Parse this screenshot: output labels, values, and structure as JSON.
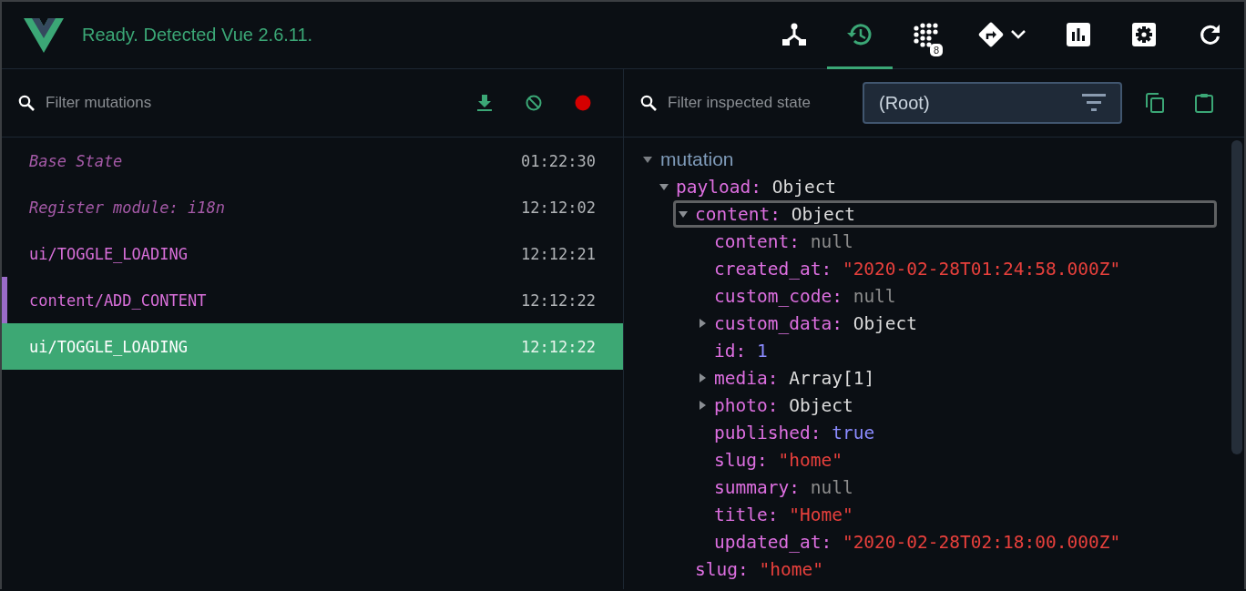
{
  "header": {
    "status": "Ready. Detected Vue 2.6.11.",
    "tabs": [
      {
        "kind": "components",
        "selected": false
      },
      {
        "kind": "vuex",
        "selected": true
      },
      {
        "kind": "events",
        "selected": false,
        "badge": "8"
      },
      {
        "kind": "routing",
        "selected": false
      },
      {
        "kind": "performance",
        "selected": false
      },
      {
        "kind": "settings",
        "selected": false
      },
      {
        "kind": "refresh",
        "selected": false
      }
    ]
  },
  "mutations_panel": {
    "filter": {
      "placeholder": "Filter mutations"
    },
    "actions": [
      {
        "kind": "export"
      },
      {
        "kind": "clear"
      },
      {
        "kind": "record",
        "on": true
      }
    ],
    "items": [
      {
        "label": "Base State",
        "time": "01:22:30",
        "kind": "meta",
        "selected": false,
        "inspected": false
      },
      {
        "label": "Register module: i18n",
        "time": "12:12:02",
        "kind": "meta",
        "selected": false,
        "inspected": false
      },
      {
        "label": "ui/TOGGLE_LOADING",
        "time": "12:12:21",
        "kind": "mutation",
        "selected": false,
        "inspected": false
      },
      {
        "label": "content/ADD_CONTENT",
        "time": "12:12:22",
        "kind": "mutation",
        "selected": false,
        "inspected": true
      },
      {
        "label": "ui/TOGGLE_LOADING",
        "time": "12:12:22",
        "kind": "mutation",
        "selected": true,
        "inspected": false
      }
    ]
  },
  "inspector": {
    "filter": {
      "placeholder": "Filter inspected state"
    },
    "module_select": {
      "value": "(Root)"
    },
    "actions": [
      {
        "kind": "copy"
      },
      {
        "kind": "paste"
      }
    ],
    "sections": [
      {
        "title": "mutation",
        "expanded": true,
        "nodes": [
          {
            "key": "payload:",
            "value": "Object",
            "kind": "object",
            "expanded": true,
            "focused": false,
            "children": [
              {
                "key": "content:",
                "value": "Object",
                "kind": "object",
                "expanded": true,
                "focused": true,
                "children": [
                  {
                    "key": "content:",
                    "value": "null",
                    "kind": "null",
                    "focused": false
                  },
                  {
                    "key": "created_at:",
                    "value": "\"2020-02-28T01:24:58.000Z\"",
                    "kind": "string",
                    "focused": false
                  },
                  {
                    "key": "custom_code:",
                    "value": "null",
                    "kind": "null",
                    "focused": false
                  },
                  {
                    "key": "custom_data:",
                    "value": "Object",
                    "kind": "object",
                    "expanded": false,
                    "focused": false
                  },
                  {
                    "key": "id:",
                    "value": "1",
                    "kind": "number",
                    "focused": false
                  },
                  {
                    "key": "media:",
                    "value": "Array[1]",
                    "kind": "object",
                    "expanded": false,
                    "focused": false
                  },
                  {
                    "key": "photo:",
                    "value": "Object",
                    "kind": "object",
                    "expanded": false,
                    "focused": false
                  },
                  {
                    "key": "published:",
                    "value": "true",
                    "kind": "boolean",
                    "focused": false
                  },
                  {
                    "key": "slug:",
                    "value": "\"home\"",
                    "kind": "string",
                    "focused": false
                  },
                  {
                    "key": "summary:",
                    "value": "null",
                    "kind": "null",
                    "focused": false
                  },
                  {
                    "key": "title:",
                    "value": "\"Home\"",
                    "kind": "string",
                    "focused": false
                  },
                  {
                    "key": "updated_at:",
                    "value": "\"2020-02-28T02:18:00.000Z\"",
                    "kind": "string",
                    "focused": false
                  }
                ]
              },
              {
                "key": "slug:",
                "value": "\"home\"",
                "kind": "string",
                "focused": false
              }
            ]
          }
        ]
      }
    ]
  }
}
